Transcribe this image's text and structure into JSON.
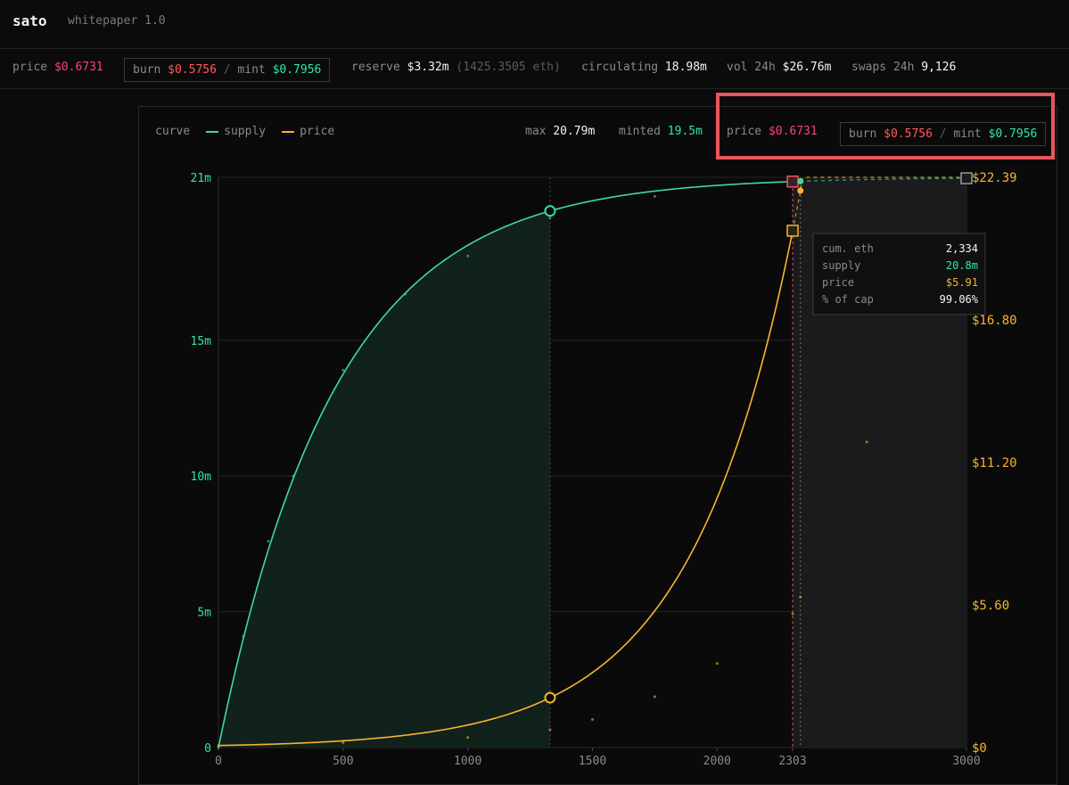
{
  "header": {
    "brand": "sato",
    "subtitle": "whitepaper 1.0"
  },
  "stats": {
    "price_label": "price",
    "price": "$0.6731",
    "burn_label": "burn",
    "burn": "$0.5756",
    "sep": "/",
    "mint_label": "mint",
    "mint": "$0.7956",
    "reserve_label": "reserve",
    "reserve": "$3.32m",
    "reserve_eth": "(1425.3505 eth)",
    "circ_label": "circulating",
    "circ": "18.98m",
    "vol_label": "vol 24h",
    "vol": "$26.76m",
    "swaps_label": "swaps 24h",
    "swaps": "9,126"
  },
  "panel": {
    "curve_label": "curve",
    "legend_supply": "supply",
    "legend_price": "price",
    "max_label": "max",
    "max": "20.79m",
    "minted_label": "minted",
    "minted": "19.5m",
    "price_label": "price",
    "price": "$0.6731",
    "burn_label": "burn",
    "burn": "$0.5756",
    "sep": "/",
    "mint_label": "mint",
    "mint": "$0.7956"
  },
  "tooltip": {
    "rows": [
      {
        "label": "cum. eth",
        "value": "2,334"
      },
      {
        "label": "supply",
        "value": "20.8m"
      },
      {
        "label": "price",
        "value": "$5.91"
      },
      {
        "label": "% of cap",
        "value": "99.06%"
      }
    ]
  },
  "colors": {
    "supply": "#3fd9a2",
    "price": "#f7b52c",
    "pink": "#ff3d8a",
    "red": "#ff5a5a",
    "green": "#2ee8a0",
    "annotation": "#e8565a"
  },
  "chart_data": {
    "type": "line",
    "xlim": [
      0,
      3000
    ],
    "xticks": [
      "0",
      "500",
      "1000",
      "1500",
      "2000",
      "2303",
      "3000"
    ],
    "xtick_values": [
      0,
      500,
      1000,
      1500,
      2000,
      2303,
      3000
    ],
    "y_left_lim": [
      0,
      21
    ],
    "y_left_ticks": [
      "0",
      "5m",
      "10m",
      "15m",
      "21m"
    ],
    "y_left_tick_values": [
      0,
      5,
      10,
      15,
      21
    ],
    "y_right_lim": [
      0,
      22.39
    ],
    "y_right_ticks": [
      "$0",
      "$5.60",
      "$11.20",
      "$16.80",
      "$22.39"
    ],
    "y_right_tick_values": [
      0,
      5.6,
      11.2,
      16.8,
      22.39
    ],
    "markers": {
      "minted_eth": 1330,
      "current_eth": 2303,
      "hover_eth": 2334,
      "max_eth": 3000
    },
    "series": [
      {
        "name": "supply",
        "x": [
          0,
          100,
          200,
          300,
          500,
          750,
          1000,
          1330,
          1750,
          2303,
          2334,
          3000
        ],
        "values": [
          0,
          4.1,
          7.6,
          10.0,
          13.9,
          16.7,
          18.1,
          19.5,
          20.3,
          20.75,
          20.8,
          20.89
        ]
      },
      {
        "name": "price",
        "x": [
          0,
          500,
          1000,
          1330,
          1500,
          1750,
          2000,
          2303,
          2334,
          2600,
          3000
        ],
        "values": [
          0.08,
          0.2,
          0.4,
          0.7,
          1.1,
          2.0,
          3.3,
          5.25,
          5.91,
          12.0,
          22.39
        ]
      }
    ]
  }
}
